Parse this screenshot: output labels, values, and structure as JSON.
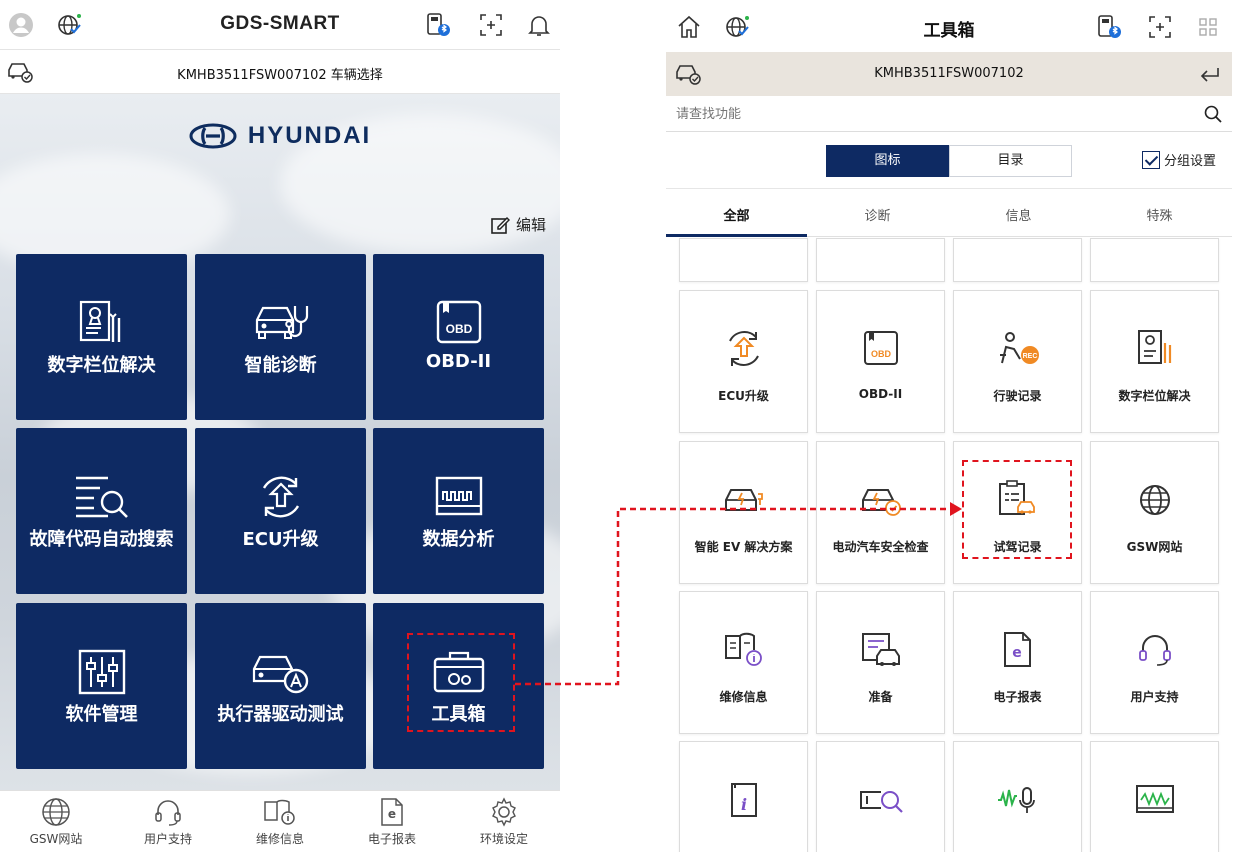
{
  "left": {
    "brand": "GDS-SMART",
    "vehicle_bar": "KMHB3511FSW007102 车辆选择",
    "logo_text": "HYUNDAI",
    "edit_label": "编辑",
    "tiles": [
      {
        "label": "数字栏位解决",
        "icon": "digital-field-icon"
      },
      {
        "label": "智能诊断",
        "icon": "smart-diagnosis-icon"
      },
      {
        "label": "OBD-II",
        "icon": "obd-icon",
        "badge": "OBD"
      },
      {
        "label": "故障代码自动搜索",
        "icon": "dtc-search-icon"
      },
      {
        "label": "ECU升级",
        "icon": "ecu-upgrade-icon"
      },
      {
        "label": "数据分析",
        "icon": "data-analysis-icon"
      },
      {
        "label": "软件管理",
        "icon": "software-icon"
      },
      {
        "label": "执行器驱动测试",
        "icon": "actuator-icon"
      },
      {
        "label": "工具箱",
        "icon": "toolbox-icon"
      }
    ],
    "bottom_nav": [
      {
        "label": "GSW网站",
        "icon": "globe-icon"
      },
      {
        "label": "用户支持",
        "icon": "headset-icon"
      },
      {
        "label": "维修信息",
        "icon": "book-info-icon"
      },
      {
        "label": "电子报表",
        "icon": "e-report-icon",
        "glyph": "e"
      },
      {
        "label": "环境设定",
        "icon": "gear-icon"
      }
    ]
  },
  "right": {
    "title": "工具箱",
    "vin": "KMHB3511FSW007102",
    "search_placeholder": "请查找功能",
    "view_toggle": [
      "图标",
      "目录"
    ],
    "group_setting": "分组设置",
    "tabs": [
      "全部",
      "诊断",
      "信息",
      "特殊"
    ],
    "grid": [
      {
        "label": "ECU升级",
        "icon": "ecu-upgrade-icon"
      },
      {
        "label": "OBD-II",
        "icon": "obd-icon",
        "badge": "OBD"
      },
      {
        "label": "行驶记录",
        "icon": "driving-record-icon",
        "badge": "REC"
      },
      {
        "label": "数字栏位解决",
        "icon": "digital-field-icon"
      },
      {
        "label": "智能 EV 解决方案",
        "icon": "ev-car-icon"
      },
      {
        "label": "电动汽车安全检查",
        "icon": "ev-safety-icon"
      },
      {
        "label": "试驾记录",
        "icon": "test-drive-icon"
      },
      {
        "label": "GSW网站",
        "icon": "globe-icon"
      },
      {
        "label": "维修信息",
        "icon": "book-info-icon"
      },
      {
        "label": "准备",
        "icon": "prep-icon"
      },
      {
        "label": "电子报表",
        "icon": "e-report-icon",
        "glyph": "e"
      },
      {
        "label": "用户支持",
        "icon": "headset-icon"
      }
    ],
    "bottom_row_icons": [
      "info-doc-icon",
      "scan-search-icon",
      "voice-icon",
      "oscilloscope-icon"
    ],
    "info_glyph": "i"
  },
  "colors": {
    "navy": "#0e2a63",
    "accent_orange": "#f08a24",
    "highlight_red": "#e0141e",
    "vin_bar_right": "#e9e4dd"
  }
}
